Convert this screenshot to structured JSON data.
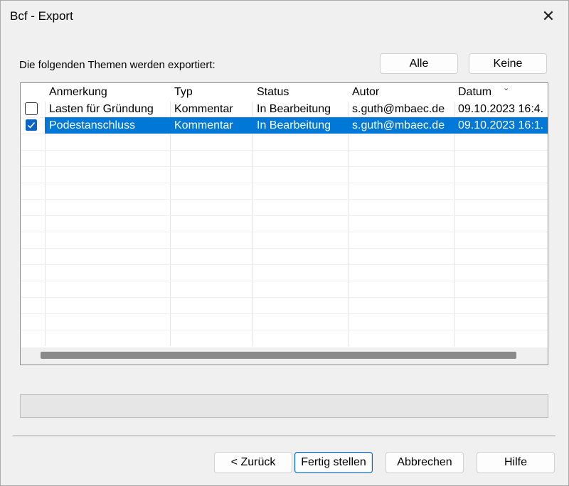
{
  "window": {
    "title": "Bcf - Export",
    "close_glyph": "✕"
  },
  "intro_label": "Die folgenden Themen werden exportiert:",
  "selection_buttons": {
    "all": "Alle",
    "none": "Keine"
  },
  "table": {
    "columns": [
      "Anmerkung",
      "Typ",
      "Status",
      "Autor",
      "Datum"
    ],
    "sort_column": "Datum",
    "sort_glyph": "⌄",
    "rows": [
      {
        "checked": false,
        "selected": false,
        "cells": [
          "Lasten für Gründung",
          "Kommentar",
          "In Bearbeitung",
          "s.guth@mbaec.de",
          "09.10.2023 16:4."
        ]
      },
      {
        "checked": true,
        "selected": true,
        "cells": [
          "Podestanschluss",
          "Kommentar",
          "In Bearbeitung",
          "s.guth@mbaec.de",
          "09.10.2023 16:1."
        ]
      }
    ]
  },
  "footer_buttons": {
    "back": "< Zurück",
    "finish": "Fertig stellen",
    "cancel": "Abbrechen",
    "help": "Hilfe"
  },
  "colors": {
    "selection": "#0078d7",
    "primary_border": "#0067c0"
  }
}
